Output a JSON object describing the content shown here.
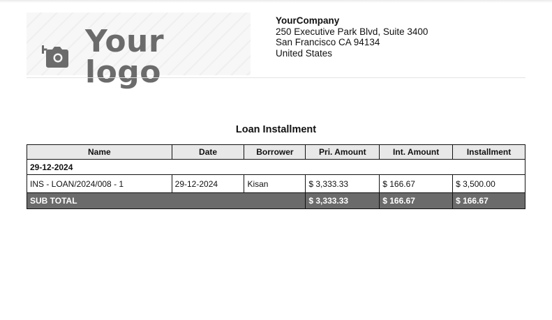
{
  "logo": {
    "text": "Your logo",
    "icon": "camera-add-icon"
  },
  "company": {
    "name": "YourCompany",
    "address_line1": "250 Executive Park Blvd, Suite 3400",
    "address_line2": "San Francisco CA 94134",
    "country": "United States"
  },
  "report": {
    "title": "Loan Installment",
    "columns": [
      "Name",
      "Date",
      "Borrower",
      "Pri. Amount",
      "Int. Amount",
      "Installment"
    ],
    "group_label": "29-12-2024",
    "rows": [
      {
        "name": "INS - LOAN/2024/008 - 1",
        "date": "29-12-2024",
        "borrower": "Kisan",
        "pri_amount": "$ 3,333.33",
        "int_amount": "$ 166.67",
        "installment": "$ 3,500.00"
      }
    ],
    "subtotal": {
      "label": "SUB TOTAL",
      "pri_amount": "$ 3,333.33",
      "int_amount": "$ 166.67",
      "installment": "$ 166.67"
    }
  },
  "colors": {
    "header_bg": "#e8e8e8",
    "subtotal_bg": "#6b6b6b",
    "logo_gray": "#6b6b6b"
  }
}
